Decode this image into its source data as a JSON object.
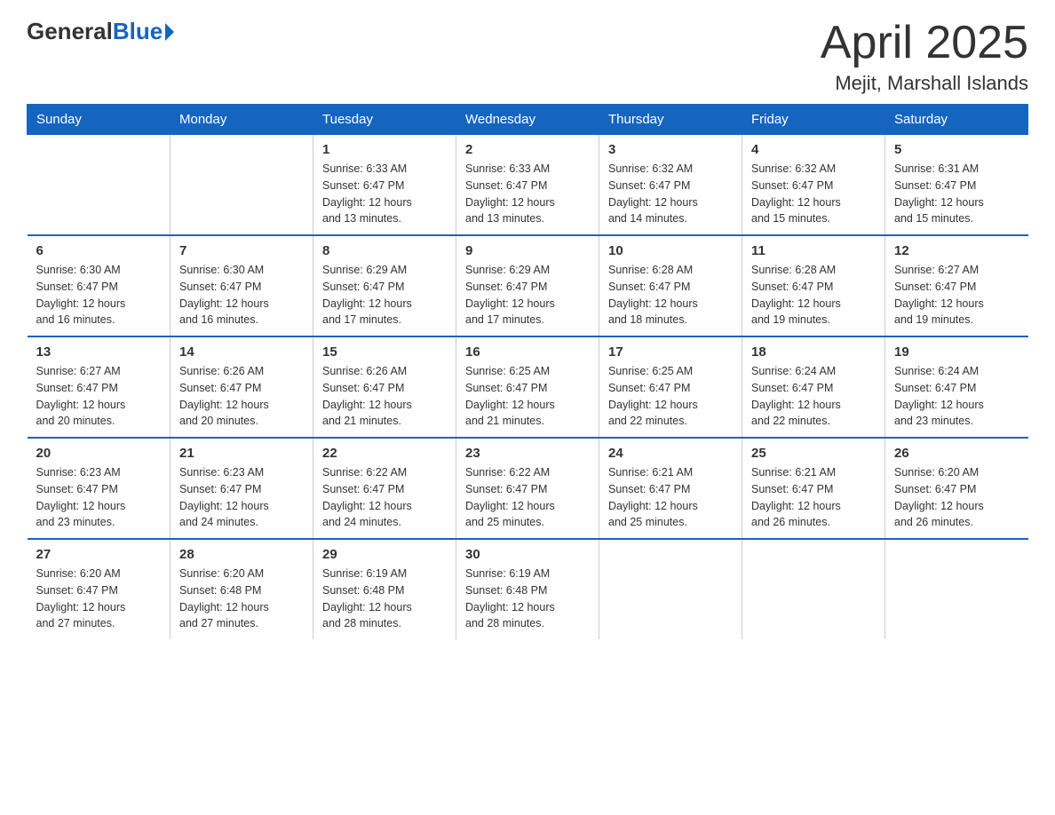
{
  "logo": {
    "general": "General",
    "blue": "Blue"
  },
  "title": "April 2025",
  "subtitle": "Mejit, Marshall Islands",
  "days_of_week": [
    "Sunday",
    "Monday",
    "Tuesday",
    "Wednesday",
    "Thursday",
    "Friday",
    "Saturday"
  ],
  "weeks": [
    [
      {
        "day": "",
        "info": ""
      },
      {
        "day": "",
        "info": ""
      },
      {
        "day": "1",
        "info": "Sunrise: 6:33 AM\nSunset: 6:47 PM\nDaylight: 12 hours\nand 13 minutes."
      },
      {
        "day": "2",
        "info": "Sunrise: 6:33 AM\nSunset: 6:47 PM\nDaylight: 12 hours\nand 13 minutes."
      },
      {
        "day": "3",
        "info": "Sunrise: 6:32 AM\nSunset: 6:47 PM\nDaylight: 12 hours\nand 14 minutes."
      },
      {
        "day": "4",
        "info": "Sunrise: 6:32 AM\nSunset: 6:47 PM\nDaylight: 12 hours\nand 15 minutes."
      },
      {
        "day": "5",
        "info": "Sunrise: 6:31 AM\nSunset: 6:47 PM\nDaylight: 12 hours\nand 15 minutes."
      }
    ],
    [
      {
        "day": "6",
        "info": "Sunrise: 6:30 AM\nSunset: 6:47 PM\nDaylight: 12 hours\nand 16 minutes."
      },
      {
        "day": "7",
        "info": "Sunrise: 6:30 AM\nSunset: 6:47 PM\nDaylight: 12 hours\nand 16 minutes."
      },
      {
        "day": "8",
        "info": "Sunrise: 6:29 AM\nSunset: 6:47 PM\nDaylight: 12 hours\nand 17 minutes."
      },
      {
        "day": "9",
        "info": "Sunrise: 6:29 AM\nSunset: 6:47 PM\nDaylight: 12 hours\nand 17 minutes."
      },
      {
        "day": "10",
        "info": "Sunrise: 6:28 AM\nSunset: 6:47 PM\nDaylight: 12 hours\nand 18 minutes."
      },
      {
        "day": "11",
        "info": "Sunrise: 6:28 AM\nSunset: 6:47 PM\nDaylight: 12 hours\nand 19 minutes."
      },
      {
        "day": "12",
        "info": "Sunrise: 6:27 AM\nSunset: 6:47 PM\nDaylight: 12 hours\nand 19 minutes."
      }
    ],
    [
      {
        "day": "13",
        "info": "Sunrise: 6:27 AM\nSunset: 6:47 PM\nDaylight: 12 hours\nand 20 minutes."
      },
      {
        "day": "14",
        "info": "Sunrise: 6:26 AM\nSunset: 6:47 PM\nDaylight: 12 hours\nand 20 minutes."
      },
      {
        "day": "15",
        "info": "Sunrise: 6:26 AM\nSunset: 6:47 PM\nDaylight: 12 hours\nand 21 minutes."
      },
      {
        "day": "16",
        "info": "Sunrise: 6:25 AM\nSunset: 6:47 PM\nDaylight: 12 hours\nand 21 minutes."
      },
      {
        "day": "17",
        "info": "Sunrise: 6:25 AM\nSunset: 6:47 PM\nDaylight: 12 hours\nand 22 minutes."
      },
      {
        "day": "18",
        "info": "Sunrise: 6:24 AM\nSunset: 6:47 PM\nDaylight: 12 hours\nand 22 minutes."
      },
      {
        "day": "19",
        "info": "Sunrise: 6:24 AM\nSunset: 6:47 PM\nDaylight: 12 hours\nand 23 minutes."
      }
    ],
    [
      {
        "day": "20",
        "info": "Sunrise: 6:23 AM\nSunset: 6:47 PM\nDaylight: 12 hours\nand 23 minutes."
      },
      {
        "day": "21",
        "info": "Sunrise: 6:23 AM\nSunset: 6:47 PM\nDaylight: 12 hours\nand 24 minutes."
      },
      {
        "day": "22",
        "info": "Sunrise: 6:22 AM\nSunset: 6:47 PM\nDaylight: 12 hours\nand 24 minutes."
      },
      {
        "day": "23",
        "info": "Sunrise: 6:22 AM\nSunset: 6:47 PM\nDaylight: 12 hours\nand 25 minutes."
      },
      {
        "day": "24",
        "info": "Sunrise: 6:21 AM\nSunset: 6:47 PM\nDaylight: 12 hours\nand 25 minutes."
      },
      {
        "day": "25",
        "info": "Sunrise: 6:21 AM\nSunset: 6:47 PM\nDaylight: 12 hours\nand 26 minutes."
      },
      {
        "day": "26",
        "info": "Sunrise: 6:20 AM\nSunset: 6:47 PM\nDaylight: 12 hours\nand 26 minutes."
      }
    ],
    [
      {
        "day": "27",
        "info": "Sunrise: 6:20 AM\nSunset: 6:47 PM\nDaylight: 12 hours\nand 27 minutes."
      },
      {
        "day": "28",
        "info": "Sunrise: 6:20 AM\nSunset: 6:48 PM\nDaylight: 12 hours\nand 27 minutes."
      },
      {
        "day": "29",
        "info": "Sunrise: 6:19 AM\nSunset: 6:48 PM\nDaylight: 12 hours\nand 28 minutes."
      },
      {
        "day": "30",
        "info": "Sunrise: 6:19 AM\nSunset: 6:48 PM\nDaylight: 12 hours\nand 28 minutes."
      },
      {
        "day": "",
        "info": ""
      },
      {
        "day": "",
        "info": ""
      },
      {
        "day": "",
        "info": ""
      }
    ]
  ]
}
